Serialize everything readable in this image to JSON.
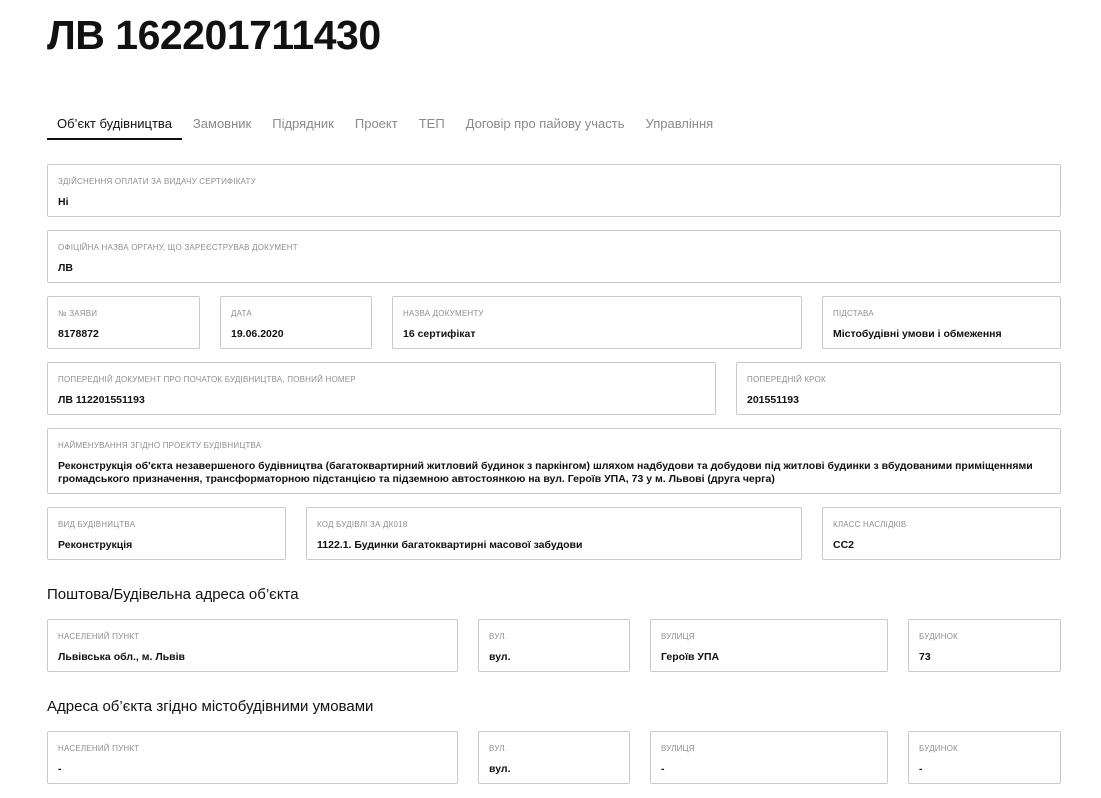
{
  "page": {
    "title": "ЛВ 162201711430"
  },
  "tabs": [
    {
      "label": "Об’єкт будівництва",
      "active": true
    },
    {
      "label": "Замовник",
      "active": false
    },
    {
      "label": "Підрядник",
      "active": false
    },
    {
      "label": "Проект",
      "active": false
    },
    {
      "label": "ТЕП",
      "active": false
    },
    {
      "label": "Договір про пайову участь",
      "active": false
    },
    {
      "label": "Управління",
      "active": false
    }
  ],
  "fields": {
    "payment": {
      "label": "Здійснення оплати за видачу сертифікату",
      "value": "Ні"
    },
    "authority": {
      "label": "Офіційна назва органу, що зареєстрував документ",
      "value": "ЛВ"
    },
    "application_no": {
      "label": "№ заяви",
      "value": "8178872"
    },
    "date": {
      "label": "Дата",
      "value": "19.06.2020"
    },
    "document_name": {
      "label": "Назва документу",
      "value": "16 сертифікат"
    },
    "basis": {
      "label": "Підстава",
      "value": "Містобудівні умови і обмеження"
    },
    "previous_document": {
      "label": "Попередній документ про початок будівництва, повний номер",
      "value": "ЛВ 112201551193"
    },
    "previous_step": {
      "label": "Попередній крок",
      "value": "201551193"
    },
    "project_name": {
      "label": "Найменування згідно проекту будівництва",
      "value": "Реконструкція об'єкта незавершеного будівництва (багатоквартирний житловий будинок з паркінгом) шляхом надбудови та добудови під житлові будинки з вбудованими приміщеннями громадського призначення, трансформаторною підстанцією та підземною автостоянкою на вул. Героїв УПА, 73 у м. Львові (друга черга)"
    },
    "construction_type": {
      "label": "Вид будівництва",
      "value": "Реконструкція"
    },
    "building_code": {
      "label": "Код будівлі за ДК018",
      "value": "1122.1. Будинки багатоквартирні масової забудови"
    },
    "consequence_class": {
      "label": "Класс наслідків",
      "value": "СС2"
    }
  },
  "postal_address": {
    "title": "Поштова/Будівельна адреса об’єкта",
    "settlement": {
      "label": "Населений пункт",
      "value": "Львівська обл., м. Львів"
    },
    "street_type": {
      "label": "Вул.",
      "value": "вул."
    },
    "street": {
      "label": "Вулиця",
      "value": "Героїв УПА"
    },
    "building": {
      "label": "Будинок",
      "value": "73"
    }
  },
  "planning_address": {
    "title": "Адреса об’єкта згідно містобудівними умовами",
    "settlement": {
      "label": "Населений пункт",
      "value": "-"
    },
    "street_type": {
      "label": "Вул.",
      "value": "вул."
    },
    "street": {
      "label": "Вулиця",
      "value": "-"
    },
    "building": {
      "label": "Будинок",
      "value": "-"
    }
  },
  "colors": {
    "text": "#111111",
    "muted": "#8a8a8a",
    "border": "#c9c9c9",
    "background": "#ffffff"
  }
}
